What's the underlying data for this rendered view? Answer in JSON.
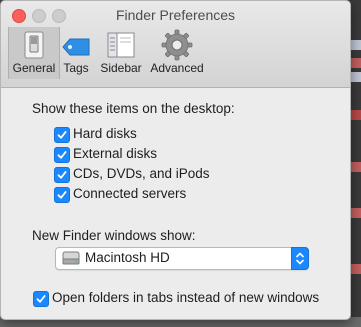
{
  "window": {
    "title": "Finder Preferences"
  },
  "toolbar": {
    "tabs": [
      {
        "label": "General",
        "icon": "general-switch-icon",
        "selected": true
      },
      {
        "label": "Tags",
        "icon": "tag-icon",
        "selected": false
      },
      {
        "label": "Sidebar",
        "icon": "sidebar-icon",
        "selected": false
      },
      {
        "label": "Advanced",
        "icon": "gear-icon",
        "selected": false
      }
    ]
  },
  "desktop_section": {
    "heading": "Show these items on the desktop:",
    "items": [
      {
        "label": "Hard disks",
        "checked": true
      },
      {
        "label": "External disks",
        "checked": true
      },
      {
        "label": "CDs, DVDs, and iPods",
        "checked": true
      },
      {
        "label": "Connected servers",
        "checked": true
      }
    ]
  },
  "new_window_section": {
    "heading": "New Finder windows show:",
    "selected": "Macintosh HD",
    "icon": "hard-drive-icon"
  },
  "tabs_option": {
    "label": "Open folders in tabs instead of new windows",
    "checked": true
  },
  "colors": {
    "accent": "#1a88ff",
    "close": "#fc605c",
    "window_bg": "#ececec"
  }
}
